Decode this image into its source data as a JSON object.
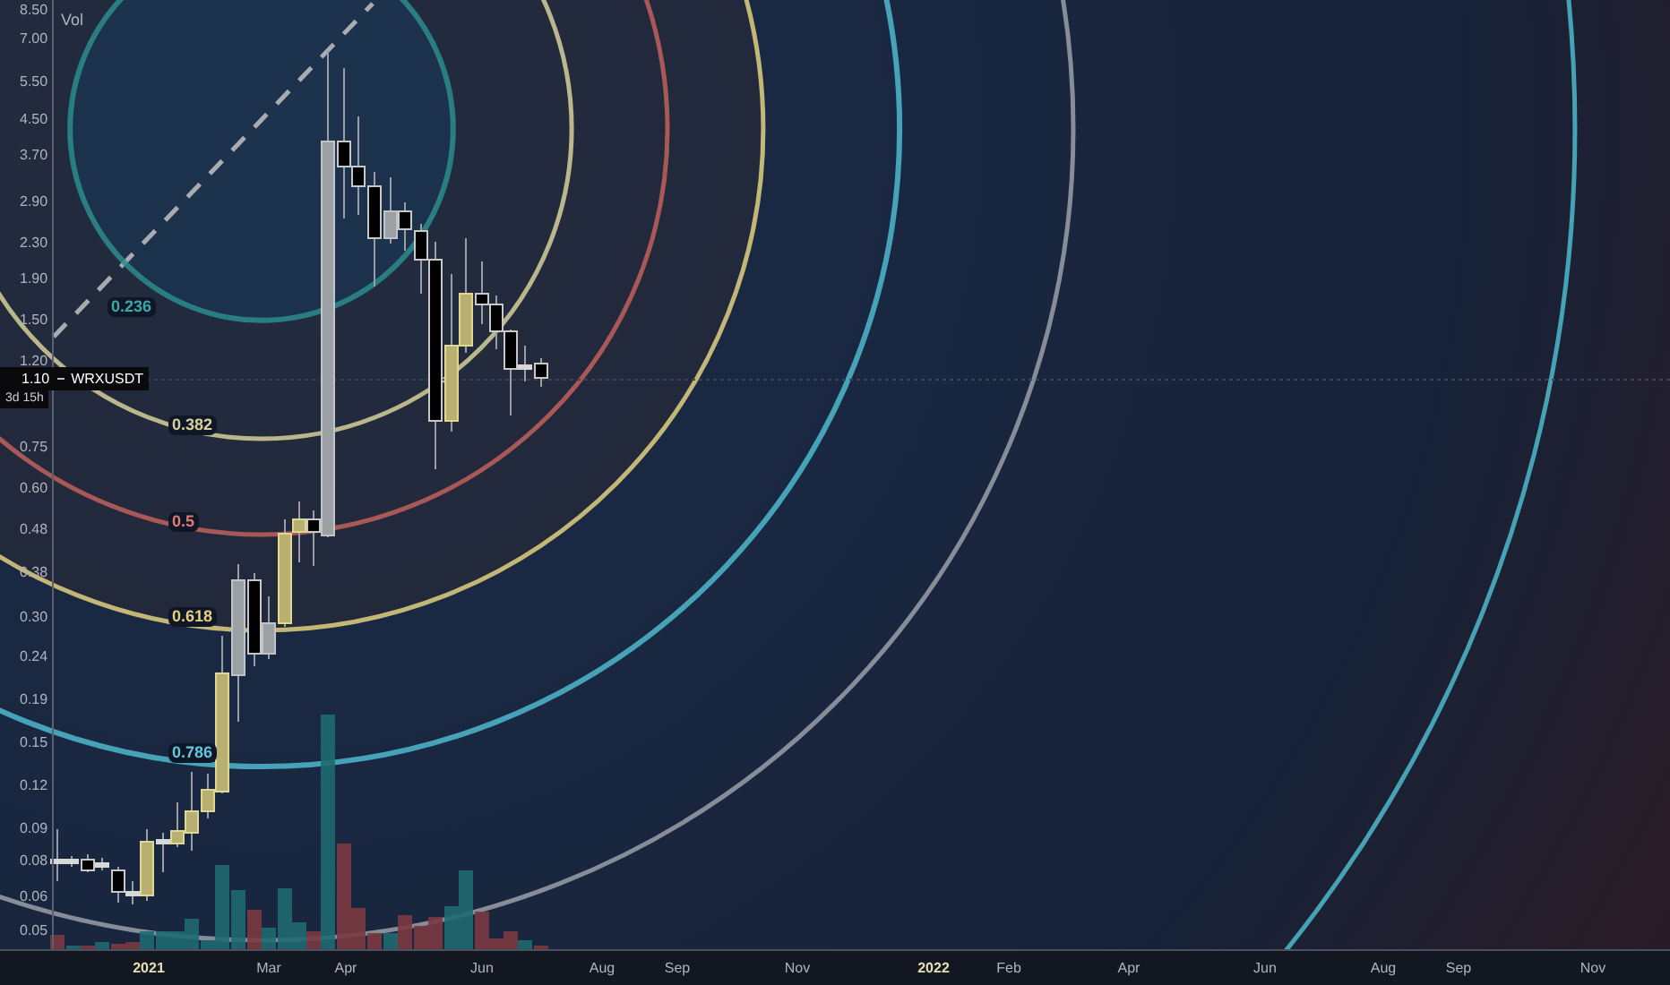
{
  "legend": {
    "label": "Vol"
  },
  "price_axis": {
    "ticks": [
      "8.50",
      "7.00",
      "5.50",
      "4.50",
      "3.70",
      "2.90",
      "2.30",
      "1.90",
      "1.50",
      "1.20",
      "0.75",
      "0.60",
      "0.48",
      "0.38",
      "0.30",
      "0.24",
      "0.19",
      "0.15",
      "0.12",
      "0.09",
      "0.08",
      "0.06",
      "0.05"
    ]
  },
  "last_price": {
    "price": "1.10",
    "symbol": "WRXUSDT",
    "countdown": "3d 15h"
  },
  "fib_labels": [
    {
      "label": "0.236",
      "color": "#3aa8a8"
    },
    {
      "label": "0.382",
      "color": "#d6d09a"
    },
    {
      "label": "0.5",
      "color": "#e07a74"
    },
    {
      "label": "0.618",
      "color": "#e0d080"
    },
    {
      "label": "0.786",
      "color": "#5fc8dc"
    }
  ],
  "time_axis": {
    "labels": [
      {
        "label": "2021",
        "kind": "year"
      },
      {
        "label": "Mar",
        "kind": "month"
      },
      {
        "label": "Apr",
        "kind": "month"
      },
      {
        "label": "Jun",
        "kind": "month"
      },
      {
        "label": "Aug",
        "kind": "month"
      },
      {
        "label": "Sep",
        "kind": "month"
      },
      {
        "label": "Nov",
        "kind": "month"
      },
      {
        "label": "2022",
        "kind": "year"
      },
      {
        "label": "Feb",
        "kind": "month"
      },
      {
        "label": "Apr",
        "kind": "month"
      },
      {
        "label": "Jun",
        "kind": "month"
      },
      {
        "label": "Aug",
        "kind": "month"
      },
      {
        "label": "Sep",
        "kind": "month"
      },
      {
        "label": "Nov",
        "kind": "month"
      }
    ]
  }
}
